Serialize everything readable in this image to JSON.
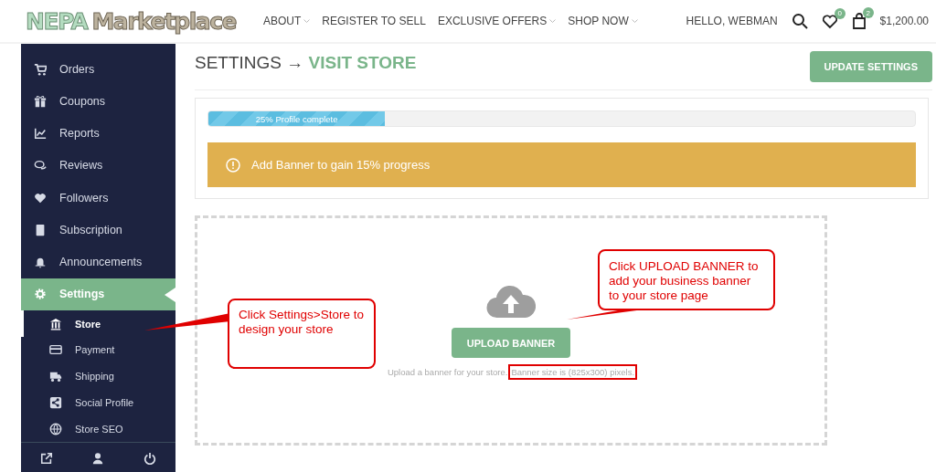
{
  "header": {
    "logo_words": [
      "NEPA",
      "Marketplace"
    ],
    "nav": [
      {
        "label": "ABOUT",
        "dropdown": true
      },
      {
        "label": "REGISTER TO SELL",
        "dropdown": false
      },
      {
        "label": "EXCLUSIVE OFFERS",
        "dropdown": true
      },
      {
        "label": "SHOP NOW",
        "dropdown": true
      }
    ],
    "greeting": "HELLO, WEBMAN",
    "wishlist_count": "0",
    "cart_count": "2",
    "cart_total": "$1,200.00"
  },
  "sidebar": {
    "items": [
      {
        "label": "Orders",
        "selected": false
      },
      {
        "label": "Coupons",
        "selected": false
      },
      {
        "label": "Reports",
        "selected": false
      },
      {
        "label": "Reviews",
        "selected": false
      },
      {
        "label": "Followers",
        "selected": false
      },
      {
        "label": "Subscription",
        "selected": false
      },
      {
        "label": "Announcements",
        "selected": false
      },
      {
        "label": "Settings",
        "selected": true
      }
    ],
    "sub_items": [
      {
        "label": "Store",
        "selected": true
      },
      {
        "label": "Payment",
        "selected": false
      },
      {
        "label": "Shipping",
        "selected": false
      },
      {
        "label": "Social Profile",
        "selected": false
      },
      {
        "label": "Store SEO",
        "selected": false
      }
    ]
  },
  "page": {
    "title": "SETTINGS →",
    "title_link": "VISIT STORE",
    "update_button": "UPDATE SETTINGS",
    "progress": {
      "label": "25% Profile complete",
      "level": 0.25
    },
    "alert": "Add Banner to gain 15% progress",
    "upload_button": "UPLOAD BANNER",
    "help_text": "Upload a banner for your store.",
    "help_size": "Banner size is (825x300) pixels."
  },
  "callouts": [
    {
      "text": "Click Settings>Store to design your store"
    },
    {
      "text": "Click UPLOAD BANNER to add your business banner to your store page"
    }
  ]
}
